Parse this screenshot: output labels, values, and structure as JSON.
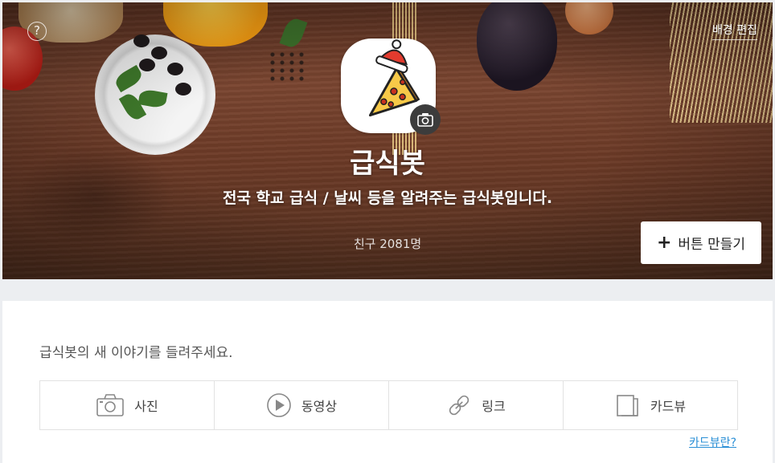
{
  "header": {
    "help_icon": "question-icon",
    "background_edit_label": "배경 편집",
    "profile_name": "급식봇",
    "profile_description": "전국 학교 급식 / 날씨 등을 알려주는 급식봇입니다.",
    "friends_count": "친구 2081명",
    "make_button_label": "버튼 만들기"
  },
  "composer": {
    "prompt": "급식봇의 새 이야기를 들려주세요.",
    "items": [
      {
        "icon": "camera-icon",
        "label": "사진"
      },
      {
        "icon": "play-icon",
        "label": "동영상"
      },
      {
        "icon": "link-icon",
        "label": "링크"
      },
      {
        "icon": "cardview-icon",
        "label": "카드뷰"
      }
    ],
    "cardview_help": "카드뷰란?"
  },
  "colors": {
    "link": "#2a8fd6",
    "card_background": "#ffffff",
    "page_background": "#eceef1"
  }
}
